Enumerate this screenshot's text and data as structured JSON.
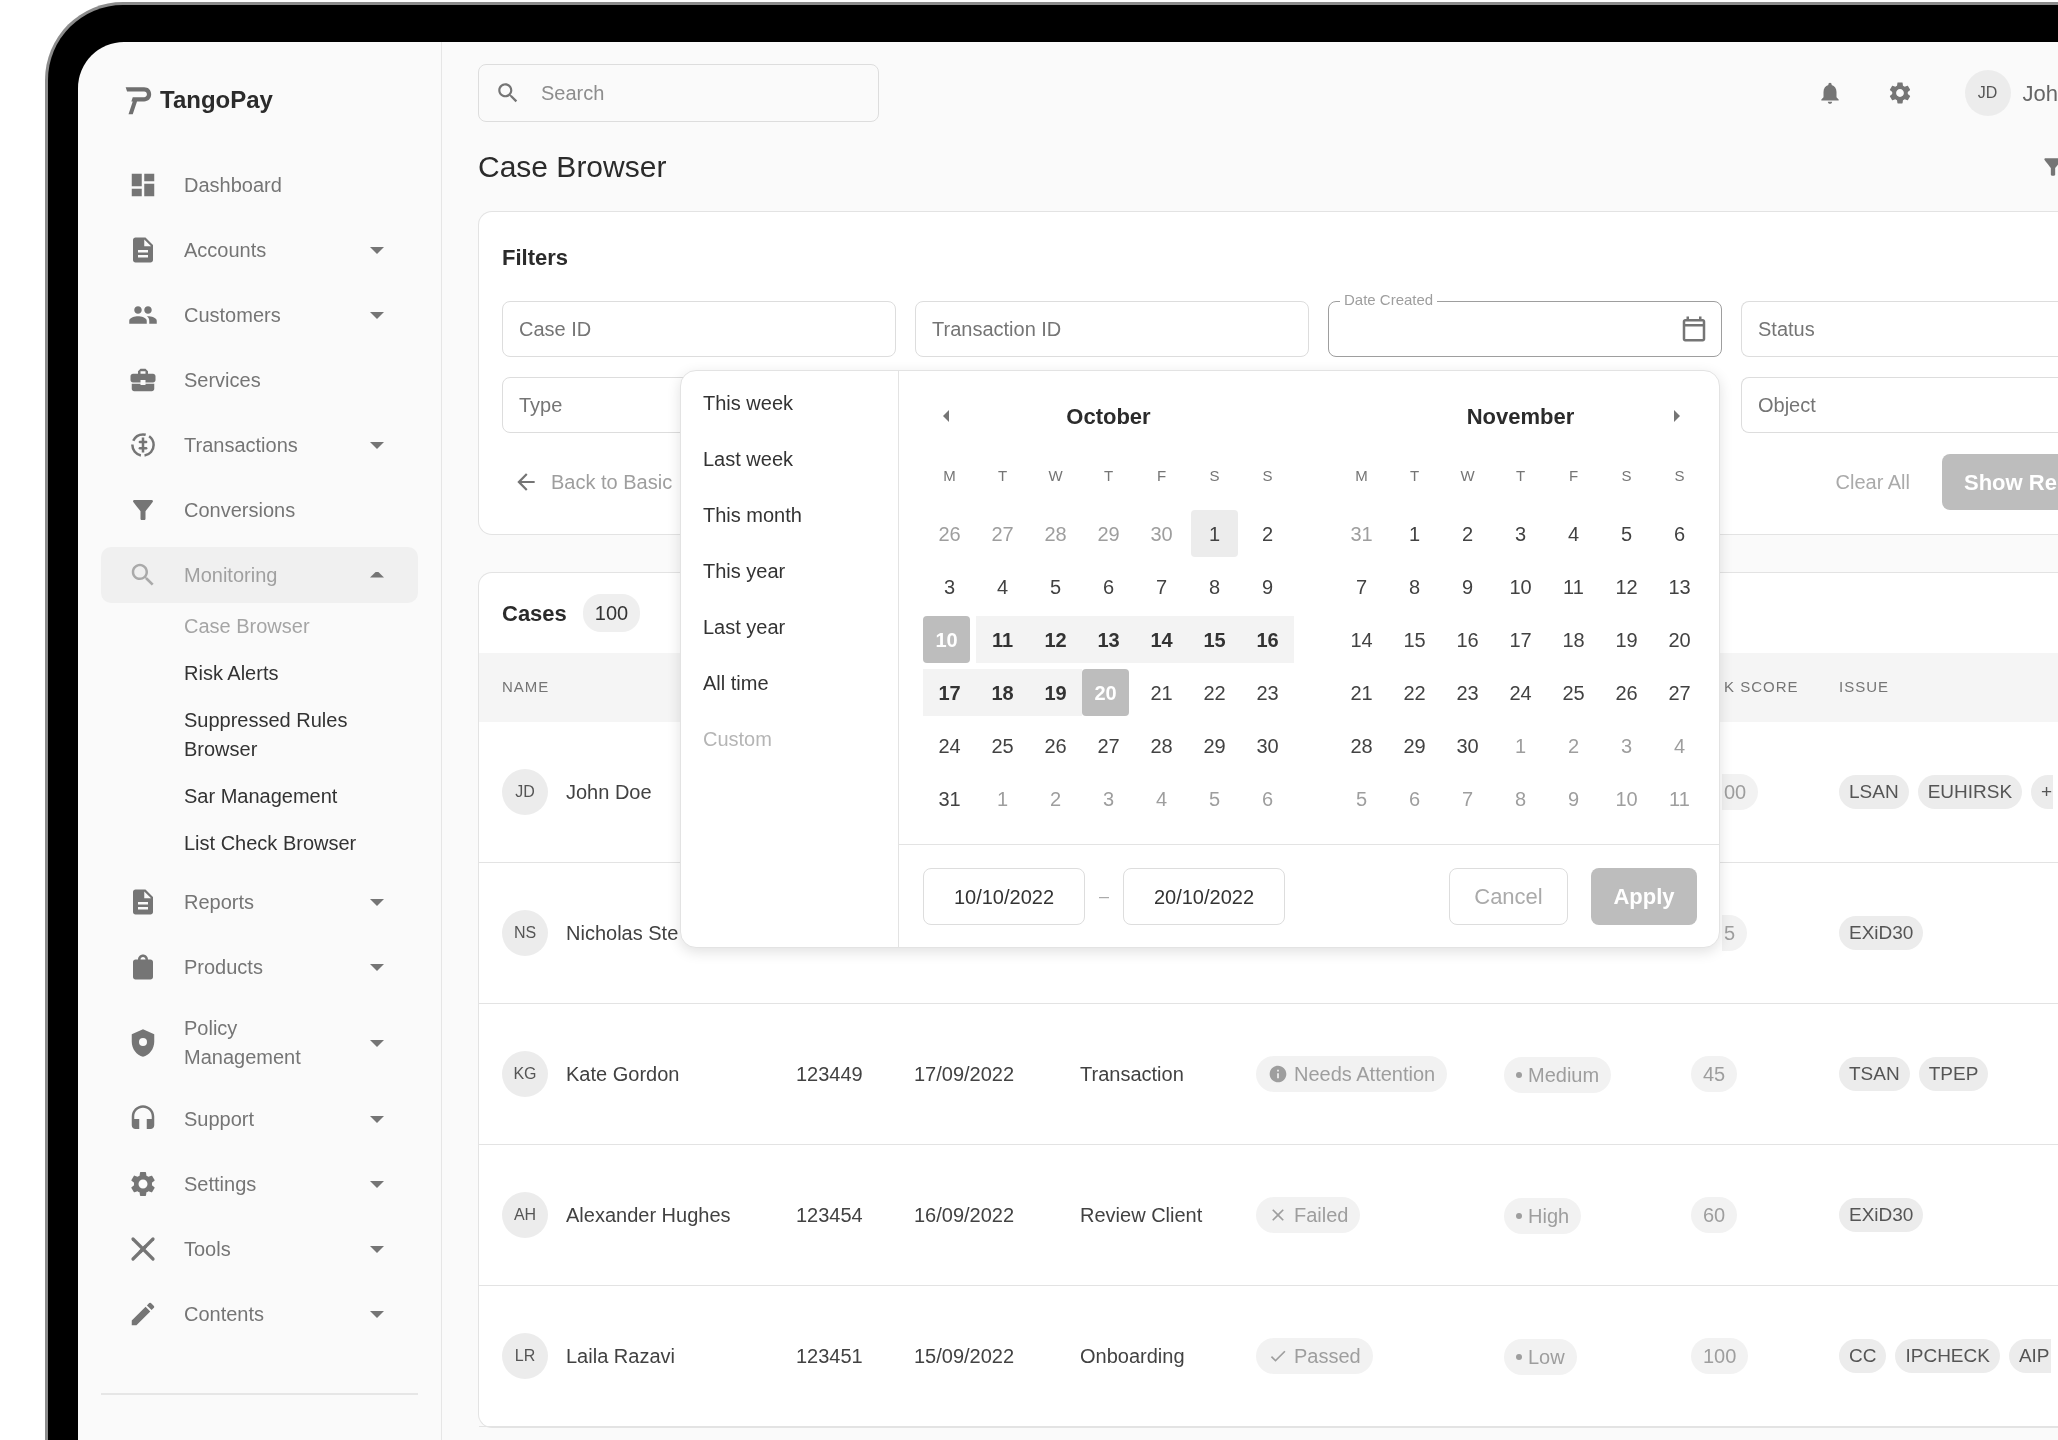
{
  "brand": {
    "name": "TangoPay"
  },
  "sidebar": {
    "items": [
      {
        "label": "Dashboard",
        "selected": false
      },
      {
        "label": "Accounts",
        "expanded": false,
        "selected": false
      },
      {
        "label": "Customers",
        "expanded": false,
        "selected": false
      },
      {
        "label": "Services",
        "selected": false
      },
      {
        "label": "Transactions",
        "expanded": false,
        "selected": false
      },
      {
        "label": "Conversions",
        "selected": false
      },
      {
        "label": "Monitoring",
        "expanded": true,
        "selected": true,
        "children": [
          {
            "label": "Case Browser",
            "selected": true
          },
          {
            "label": "Risk Alerts",
            "selected": false
          },
          {
            "label": "Suppressed Rules Browser",
            "selected": false
          },
          {
            "label": "Sar Management",
            "selected": false
          },
          {
            "label": "List Check Browser",
            "selected": false
          }
        ]
      },
      {
        "label": "Reports",
        "expanded": false,
        "selected": false
      },
      {
        "label": "Products",
        "expanded": false,
        "selected": false
      },
      {
        "label": "Policy Management",
        "expanded": false,
        "selected": false
      },
      {
        "label": "Support",
        "expanded": false,
        "selected": false
      },
      {
        "label": "Settings",
        "expanded": false,
        "selected": false
      },
      {
        "label": "Tools",
        "expanded": false,
        "selected": false
      },
      {
        "label": "Contents",
        "expanded": false,
        "selected": false
      }
    ]
  },
  "header": {
    "search": {
      "placeholder": "Search"
    },
    "user": {
      "initials": "JD",
      "name": "Joh"
    }
  },
  "page_title": "Case Browser",
  "filters": {
    "title": "Filters",
    "fields": [
      {
        "kind": "text",
        "placeholder": "Case ID"
      },
      {
        "kind": "text",
        "placeholder": "Transaction ID"
      },
      {
        "kind": "date",
        "label": "Date Created"
      },
      {
        "kind": "text",
        "placeholder": "Status"
      },
      {
        "kind": "text",
        "placeholder": "Type"
      },
      {
        "kind": "text",
        "placeholder": "Object"
      }
    ],
    "back_link": "Back to Basic",
    "clear_button": "Clear All",
    "submit_button": "Show Re"
  },
  "cases": {
    "title": "Cases",
    "count": "100",
    "columns": {
      "name": "NAME",
      "score": "K SCORE",
      "issue": "ISSUE"
    },
    "rows": [
      {
        "initials": "JD",
        "name": "John Doe",
        "score": "00",
        "issues": [
          "LSAN",
          "EUHIRSK",
          "+"
        ]
      },
      {
        "initials": "NS",
        "name": "Nicholas Ste",
        "score": "5",
        "issues": [
          "EXiD30"
        ]
      },
      {
        "initials": "KG",
        "name": "Kate Gordon",
        "id": "123449",
        "date": "17/09/2022",
        "type": "Transaction",
        "status": {
          "label": "Needs Attention",
          "kind": "attention"
        },
        "priority": "Medium",
        "score": "45",
        "issues": [
          "TSAN",
          "TPEP"
        ]
      },
      {
        "initials": "AH",
        "name": "Alexander Hughes",
        "id": "123454",
        "date": "16/09/2022",
        "type": "Review Client",
        "status": {
          "label": "Failed",
          "kind": "failed"
        },
        "priority": "High",
        "score": "60",
        "issues": [
          "EXiD30"
        ]
      },
      {
        "initials": "LR",
        "name": "Laila Razavi",
        "id": "123451",
        "date": "15/09/2022",
        "type": "Onboarding",
        "status": {
          "label": "Passed",
          "kind": "passed"
        },
        "priority": "Low",
        "score": "100",
        "issues": [
          "CC",
          "IPCHECK",
          "AIP"
        ]
      }
    ]
  },
  "date_picker": {
    "presets": [
      {
        "label": "This week",
        "disabled": false
      },
      {
        "label": "Last week",
        "disabled": false
      },
      {
        "label": "This month",
        "disabled": false
      },
      {
        "label": "This year",
        "disabled": false
      },
      {
        "label": "Last year",
        "disabled": false
      },
      {
        "label": "All time",
        "disabled": false
      },
      {
        "label": "Custom",
        "disabled": true
      }
    ],
    "months": [
      {
        "name": "October",
        "weekdays": [
          "M",
          "T",
          "W",
          "T",
          "F",
          "S",
          "S"
        ],
        "weeks": [
          [
            {
              "label": "26",
              "muted": true,
              "today": false,
              "in_range": false,
              "selected": false
            },
            {
              "label": "27",
              "muted": true,
              "today": false,
              "in_range": false,
              "selected": false
            },
            {
              "label": "28",
              "muted": true,
              "today": false,
              "in_range": false,
              "selected": false
            },
            {
              "label": "29",
              "muted": true,
              "today": false,
              "in_range": false,
              "selected": false
            },
            {
              "label": "30",
              "muted": true,
              "today": false,
              "in_range": false,
              "selected": false
            },
            {
              "label": "1",
              "muted": false,
              "today": true,
              "in_range": false,
              "selected": false
            },
            {
              "label": "2",
              "muted": false,
              "today": false,
              "in_range": false,
              "selected": false
            }
          ],
          [
            {
              "label": "3",
              "muted": false,
              "today": false,
              "in_range": false,
              "selected": false
            },
            {
              "label": "4",
              "muted": false,
              "today": false,
              "in_range": false,
              "selected": false
            },
            {
              "label": "5",
              "muted": false,
              "today": false,
              "in_range": false,
              "selected": false
            },
            {
              "label": "6",
              "muted": false,
              "today": false,
              "in_range": false,
              "selected": false
            },
            {
              "label": "7",
              "muted": false,
              "today": false,
              "in_range": false,
              "selected": false
            },
            {
              "label": "8",
              "muted": false,
              "today": false,
              "in_range": false,
              "selected": false
            },
            {
              "label": "9",
              "muted": false,
              "today": false,
              "in_range": false,
              "selected": false
            }
          ],
          [
            {
              "label": "10",
              "muted": false,
              "today": false,
              "in_range": true,
              "selected": true
            },
            {
              "label": "11",
              "muted": false,
              "today": false,
              "in_range": true,
              "selected": false
            },
            {
              "label": "12",
              "muted": false,
              "today": false,
              "in_range": true,
              "selected": false
            },
            {
              "label": "13",
              "muted": false,
              "today": false,
              "in_range": true,
              "selected": false
            },
            {
              "label": "14",
              "muted": false,
              "today": false,
              "in_range": true,
              "selected": false
            },
            {
              "label": "15",
              "muted": false,
              "today": false,
              "in_range": true,
              "selected": false
            },
            {
              "label": "16",
              "muted": false,
              "today": false,
              "in_range": true,
              "selected": false
            }
          ],
          [
            {
              "label": "17",
              "muted": false,
              "today": false,
              "in_range": true,
              "selected": false
            },
            {
              "label": "18",
              "muted": false,
              "today": false,
              "in_range": true,
              "selected": false
            },
            {
              "label": "19",
              "muted": false,
              "today": false,
              "in_range": true,
              "selected": false
            },
            {
              "label": "20",
              "muted": false,
              "today": false,
              "in_range": true,
              "selected": true
            },
            {
              "label": "21",
              "muted": false,
              "today": false,
              "in_range": false,
              "selected": false
            },
            {
              "label": "22",
              "muted": false,
              "today": false,
              "in_range": false,
              "selected": false
            },
            {
              "label": "23",
              "muted": false,
              "today": false,
              "in_range": false,
              "selected": false
            }
          ],
          [
            {
              "label": "24",
              "muted": false,
              "today": false,
              "in_range": false,
              "selected": false
            },
            {
              "label": "25",
              "muted": false,
              "today": false,
              "in_range": false,
              "selected": false
            },
            {
              "label": "26",
              "muted": false,
              "today": false,
              "in_range": false,
              "selected": false
            },
            {
              "label": "27",
              "muted": false,
              "today": false,
              "in_range": false,
              "selected": false
            },
            {
              "label": "28",
              "muted": false,
              "today": false,
              "in_range": false,
              "selected": false
            },
            {
              "label": "29",
              "muted": false,
              "today": false,
              "in_range": false,
              "selected": false
            },
            {
              "label": "30",
              "muted": false,
              "today": false,
              "in_range": false,
              "selected": false
            }
          ],
          [
            {
              "label": "31",
              "muted": false,
              "today": false,
              "in_range": false,
              "selected": false
            },
            {
              "label": "1",
              "muted": true,
              "today": false,
              "in_range": false,
              "selected": false
            },
            {
              "label": "2",
              "muted": true,
              "today": false,
              "in_range": false,
              "selected": false
            },
            {
              "label": "3",
              "muted": true,
              "today": false,
              "in_range": false,
              "selected": false
            },
            {
              "label": "4",
              "muted": true,
              "today": false,
              "in_range": false,
              "selected": false
            },
            {
              "label": "5",
              "muted": true,
              "today": false,
              "in_range": false,
              "selected": false
            },
            {
              "label": "6",
              "muted": true,
              "today": false,
              "in_range": false,
              "selected": false
            }
          ]
        ]
      },
      {
        "name": "November",
        "weekdays": [
          "M",
          "T",
          "W",
          "T",
          "F",
          "S",
          "S"
        ],
        "weeks": [
          [
            {
              "label": "31",
              "muted": true,
              "today": false,
              "in_range": false,
              "selected": false
            },
            {
              "label": "1",
              "muted": false,
              "today": false,
              "in_range": false,
              "selected": false
            },
            {
              "label": "2",
              "muted": false,
              "today": false,
              "in_range": false,
              "selected": false
            },
            {
              "label": "3",
              "muted": false,
              "today": false,
              "in_range": false,
              "selected": false
            },
            {
              "label": "4",
              "muted": false,
              "today": false,
              "in_range": false,
              "selected": false
            },
            {
              "label": "5",
              "muted": false,
              "today": false,
              "in_range": false,
              "selected": false
            },
            {
              "label": "6",
              "muted": false,
              "today": false,
              "in_range": false,
              "selected": false
            }
          ],
          [
            {
              "label": "7",
              "muted": false,
              "today": false,
              "in_range": false,
              "selected": false
            },
            {
              "label": "8",
              "muted": false,
              "today": false,
              "in_range": false,
              "selected": false
            },
            {
              "label": "9",
              "muted": false,
              "today": false,
              "in_range": false,
              "selected": false
            },
            {
              "label": "10",
              "muted": false,
              "today": false,
              "in_range": false,
              "selected": false
            },
            {
              "label": "11",
              "muted": false,
              "today": false,
              "in_range": false,
              "selected": false
            },
            {
              "label": "12",
              "muted": false,
              "today": false,
              "in_range": false,
              "selected": false
            },
            {
              "label": "13",
              "muted": false,
              "today": false,
              "in_range": false,
              "selected": false
            }
          ],
          [
            {
              "label": "14",
              "muted": false,
              "today": false,
              "in_range": false,
              "selected": false
            },
            {
              "label": "15",
              "muted": false,
              "today": false,
              "in_range": false,
              "selected": false
            },
            {
              "label": "16",
              "muted": false,
              "today": false,
              "in_range": false,
              "selected": false
            },
            {
              "label": "17",
              "muted": false,
              "today": false,
              "in_range": false,
              "selected": false
            },
            {
              "label": "18",
              "muted": false,
              "today": false,
              "in_range": false,
              "selected": false
            },
            {
              "label": "19",
              "muted": false,
              "today": false,
              "in_range": false,
              "selected": false
            },
            {
              "label": "20",
              "muted": false,
              "today": false,
              "in_range": false,
              "selected": false
            }
          ],
          [
            {
              "label": "21",
              "muted": false,
              "today": false,
              "in_range": false,
              "selected": false
            },
            {
              "label": "22",
              "muted": false,
              "today": false,
              "in_range": false,
              "selected": false
            },
            {
              "label": "23",
              "muted": false,
              "today": false,
              "in_range": false,
              "selected": false
            },
            {
              "label": "24",
              "muted": false,
              "today": false,
              "in_range": false,
              "selected": false
            },
            {
              "label": "25",
              "muted": false,
              "today": false,
              "in_range": false,
              "selected": false
            },
            {
              "label": "26",
              "muted": false,
              "today": false,
              "in_range": false,
              "selected": false
            },
            {
              "label": "27",
              "muted": false,
              "today": false,
              "in_range": false,
              "selected": false
            }
          ],
          [
            {
              "label": "28",
              "muted": false,
              "today": false,
              "in_range": false,
              "selected": false
            },
            {
              "label": "29",
              "muted": false,
              "today": false,
              "in_range": false,
              "selected": false
            },
            {
              "label": "30",
              "muted": false,
              "today": false,
              "in_range": false,
              "selected": false
            },
            {
              "label": "1",
              "muted": true,
              "today": false,
              "in_range": false,
              "selected": false
            },
            {
              "label": "2",
              "muted": true,
              "today": false,
              "in_range": false,
              "selected": false
            },
            {
              "label": "3",
              "muted": true,
              "today": false,
              "in_range": false,
              "selected": false
            },
            {
              "label": "4",
              "muted": true,
              "today": false,
              "in_range": false,
              "selected": false
            }
          ],
          [
            {
              "label": "5",
              "muted": true,
              "today": false,
              "in_range": false,
              "selected": false
            },
            {
              "label": "6",
              "muted": true,
              "today": false,
              "in_range": false,
              "selected": false
            },
            {
              "label": "7",
              "muted": true,
              "today": false,
              "in_range": false,
              "selected": false
            },
            {
              "label": "8",
              "muted": true,
              "today": false,
              "in_range": false,
              "selected": false
            },
            {
              "label": "9",
              "muted": true,
              "today": false,
              "in_range": false,
              "selected": false
            },
            {
              "label": "10",
              "muted": true,
              "today": false,
              "in_range": false,
              "selected": false
            },
            {
              "label": "11",
              "muted": true,
              "today": false,
              "in_range": false,
              "selected": false
            }
          ]
        ]
      }
    ],
    "start_date": "10/10/2022",
    "separator": "–",
    "end_date": "20/10/2022",
    "cancel_button": "Cancel",
    "apply_button": "Apply"
  }
}
